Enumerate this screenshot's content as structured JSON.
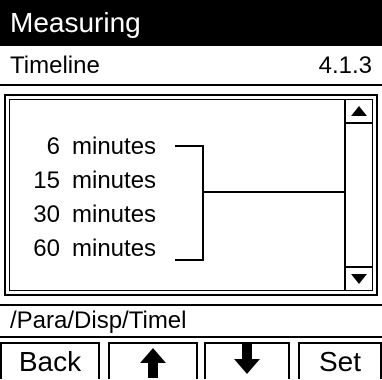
{
  "header": {
    "title": "Measuring"
  },
  "subheader": {
    "title": "Timeline",
    "code": "4.1.3"
  },
  "list": {
    "items": [
      {
        "num": "6",
        "unit": "minutes"
      },
      {
        "num": "15",
        "unit": "minutes"
      },
      {
        "num": "30",
        "unit": "minutes"
      },
      {
        "num": "60",
        "unit": "minutes"
      }
    ]
  },
  "path": "/Para/Disp/Timel",
  "keys": {
    "back": "Back",
    "set": "Set"
  },
  "icons": {
    "up": "arrow-up-icon",
    "down": "arrow-down-icon",
    "scroll_up": "scroll-up-icon",
    "scroll_down": "scroll-down-icon"
  }
}
